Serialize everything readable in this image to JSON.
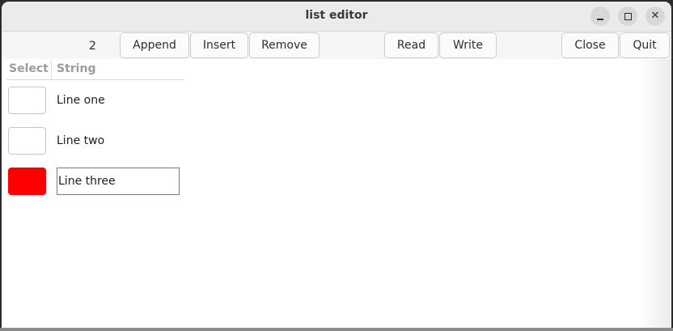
{
  "window": {
    "title": "list editor",
    "controls": {
      "minimize_icon": "minimize-icon",
      "maximize_icon": "maximize-icon",
      "close_icon": "close-icon",
      "close_glyph": "✕"
    }
  },
  "toolbar": {
    "count": "2",
    "append_label": "Append",
    "insert_label": "Insert",
    "remove_label": "Remove",
    "read_label": "Read",
    "write_label": "Write",
    "close_label": "Close",
    "quit_label": "Quit"
  },
  "list": {
    "columns": [
      "Select",
      "String"
    ],
    "rows": [
      {
        "selected": false,
        "text": "Line one",
        "editing": false,
        "swatch_color": "#ffffff"
      },
      {
        "selected": false,
        "text": "Line two",
        "editing": false,
        "swatch_color": "#ffffff"
      },
      {
        "selected": true,
        "text": "Line three",
        "editing": true,
        "swatch_color": "#ff0000"
      }
    ]
  },
  "colors": {
    "selected_swatch": "#ff0000",
    "titlebar_bg": "#ebebeb"
  }
}
